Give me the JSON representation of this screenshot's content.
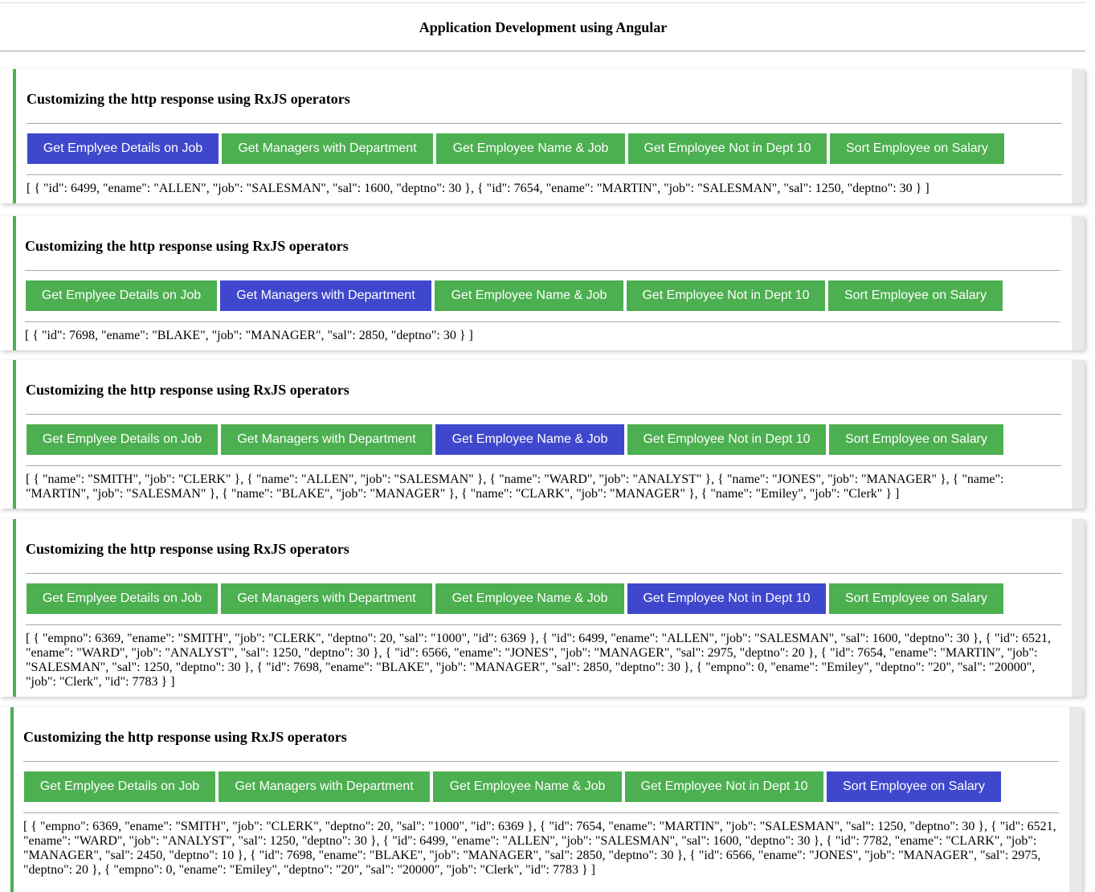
{
  "app_title": "Application Development using Angular",
  "buttons": [
    "Get Emplyee Details on Job",
    "Get Managers with Department",
    "Get Employee Name & Job",
    "Get Employee Not in Dept 10",
    "Sort Employee on Salary"
  ],
  "panels": [
    {
      "heading": "Customizing the http response using RxJS operators",
      "active_button": 0,
      "output": "[ { \"id\": 6499, \"ename\": \"ALLEN\", \"job\": \"SALESMAN\", \"sal\": 1600, \"deptno\": 30 }, { \"id\": 7654, \"ename\": \"MARTIN\", \"job\": \"SALESMAN\", \"sal\": 1250, \"deptno\": 30 } ]"
    },
    {
      "heading": "Customizing the http response using RxJS operators",
      "active_button": 1,
      "output": "[ { \"id\": 7698, \"ename\": \"BLAKE\", \"job\": \"MANAGER\", \"sal\": 2850, \"deptno\": 30 } ]"
    },
    {
      "heading": "Customizing the http response using RxJS operators",
      "active_button": 2,
      "output": "[ { \"name\": \"SMITH\", \"job\": \"CLERK\" }, { \"name\": \"ALLEN\", \"job\": \"SALESMAN\" }, { \"name\": \"WARD\", \"job\": \"ANALYST\" }, { \"name\": \"JONES\", \"job\": \"MANAGER\" }, { \"name\": \"MARTIN\", \"job\": \"SALESMAN\" }, { \"name\": \"BLAKE\", \"job\": \"MANAGER\" }, { \"name\": \"CLARK\", \"job\": \"MANAGER\" }, { \"name\": \"Emiley\", \"job\": \"Clerk\" } ]"
    },
    {
      "heading": "Customizing the http response using RxJS operators",
      "active_button": 3,
      "output": "[ { \"empno\": 6369, \"ename\": \"SMITH\", \"job\": \"CLERK\", \"deptno\": 20, \"sal\": \"1000\", \"id\": 6369 }, { \"id\": 6499, \"ename\": \"ALLEN\", \"job\": \"SALESMAN\", \"sal\": 1600, \"deptno\": 30 }, { \"id\": 6521, \"ename\": \"WARD\", \"job\": \"ANALYST\", \"sal\": 1250, \"deptno\": 30 }, { \"id\": 6566, \"ename\": \"JONES\", \"job\": \"MANAGER\", \"sal\": 2975, \"deptno\": 20 }, { \"id\": 7654, \"ename\": \"MARTIN\", \"job\": \"SALESMAN\", \"sal\": 1250, \"deptno\": 30 }, { \"id\": 7698, \"ename\": \"BLAKE\", \"job\": \"MANAGER\", \"sal\": 2850, \"deptno\": 30 }, { \"empno\": 0, \"ename\": \"Emiley\", \"deptno\": \"20\", \"sal\": \"20000\", \"job\": \"Clerk\", \"id\": 7783 } ]"
    },
    {
      "heading": "Customizing the http response using RxJS operators",
      "active_button": 4,
      "output": "[ { \"empno\": 6369, \"ename\": \"SMITH\", \"job\": \"CLERK\", \"deptno\": 20, \"sal\": \"1000\", \"id\": 6369 }, { \"id\": 7654, \"ename\": \"MARTIN\", \"job\": \"SALESMAN\", \"sal\": 1250, \"deptno\": 30 }, { \"id\": 6521, \"ename\": \"WARD\", \"job\": \"ANALYST\", \"sal\": 1250, \"deptno\": 30 }, { \"id\": 6499, \"ename\": \"ALLEN\", \"job\": \"SALESMAN\", \"sal\": 1600, \"deptno\": 30 }, { \"id\": 7782, \"ename\": \"CLARK\", \"job\": \"MANAGER\", \"sal\": 2450, \"deptno\": 10 }, { \"id\": 7698, \"ename\": \"BLAKE\", \"job\": \"MANAGER\", \"sal\": 2850, \"deptno\": 30 }, { \"id\": 6566, \"ename\": \"JONES\", \"job\": \"MANAGER\", \"sal\": 2975, \"deptno\": 20 }, { \"empno\": 0, \"ename\": \"Emiley\", \"deptno\": \"20\", \"sal\": \"20000\", \"job\": \"Clerk\", \"id\": 7783 } ]"
    }
  ],
  "colors": {
    "button": "#4caf50",
    "button_active": "#3f48cc",
    "accent": "#4caf50"
  }
}
